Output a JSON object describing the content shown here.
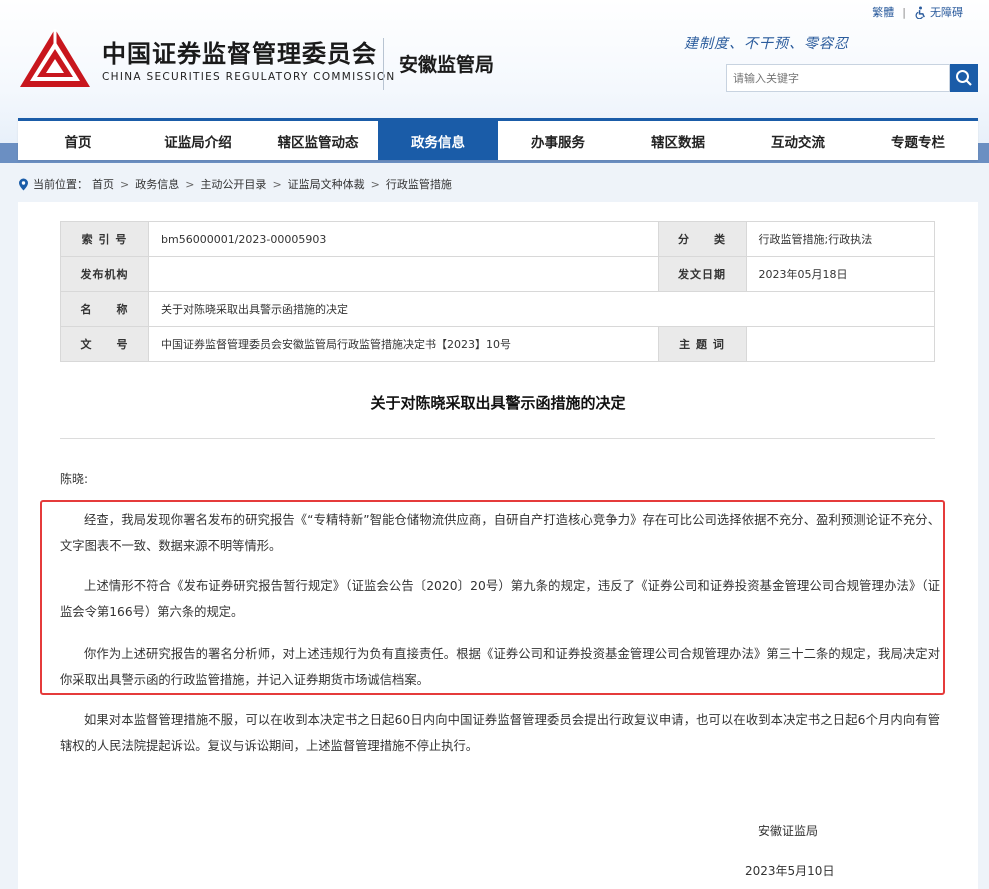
{
  "topbar": {
    "traditional": "繁體",
    "accessibility": "无障碍"
  },
  "header": {
    "org_cn": "中国证券监督管理委员会",
    "org_en": "CHINA SECURITIES REGULATORY COMMISSION",
    "bureau": "安徽监管局",
    "slogan": "建制度、不干预、零容忍"
  },
  "search": {
    "placeholder": "请输入关键字"
  },
  "nav": {
    "items": [
      "首页",
      "证监局介绍",
      "辖区监管动态",
      "政务信息",
      "办事服务",
      "辖区数据",
      "互动交流",
      "专题专栏"
    ],
    "active_index": 3
  },
  "breadcrumb": {
    "prefix": "当前位置：",
    "items": [
      "首页",
      "政务信息",
      "主动公开目录",
      "证监局文种体裁",
      "行政监管措施"
    ]
  },
  "meta": {
    "index_label": "索 引 号",
    "index_value": "bm56000001/2023-00005903",
    "category_label": "分　　类",
    "category_value": "行政监管措施;行政执法",
    "publisher_label": "发布机构",
    "publisher_value": "",
    "date_label": "发文日期",
    "date_value": "2023年05月18日",
    "name_label": "名　　称",
    "name_value": "关于对陈晓采取出具警示函措施的决定",
    "docno_label": "文　　号",
    "docno_value": "中国证券监督管理委员会安徽监管局行政监管措施决定书【2023】10号",
    "subject_label": "主 题 词",
    "subject_value": ""
  },
  "document": {
    "title": "关于对陈晓采取出具警示函措施的决定",
    "salutation": "陈晓:",
    "p1": "经查，我局发现你署名发布的研究报告《“专精特新”智能仓储物流供应商，自研自产打造核心竞争力》存在可比公司选择依据不充分、盈利预测论证不充分、文字图表不一致、数据来源不明等情形。",
    "p2": "上述情形不符合《发布证券研究报告暂行规定》（证监会公告〔2020〕20号）第九条的规定，违反了《证券公司和证券投资基金管理公司合规管理办法》（证监会令第166号）第六条的规定。",
    "p3": "你作为上述研究报告的署名分析师，对上述违规行为负有直接责任。根据《证券公司和证券投资基金管理公司合规管理办法》第三十二条的规定，我局决定对你采取出具警示函的行政监管措施，并记入证券期货市场诚信档案。",
    "p4": "如果对本监督管理措施不服，可以在收到本决定书之日起60日内向中国证券监督管理委员会提出行政复议申请，也可以在收到本决定书之日起6个月内向有管辖权的人民法院提起诉讼。复议与诉讼期间，上述监督管理措施不停止执行。",
    "signer": "安徽证监局",
    "sign_date": "2023年5月10日"
  },
  "colors": {
    "brand_blue": "#1a5ca8",
    "logo_red": "#c8161d",
    "highlight_red": "#e53b3b"
  }
}
